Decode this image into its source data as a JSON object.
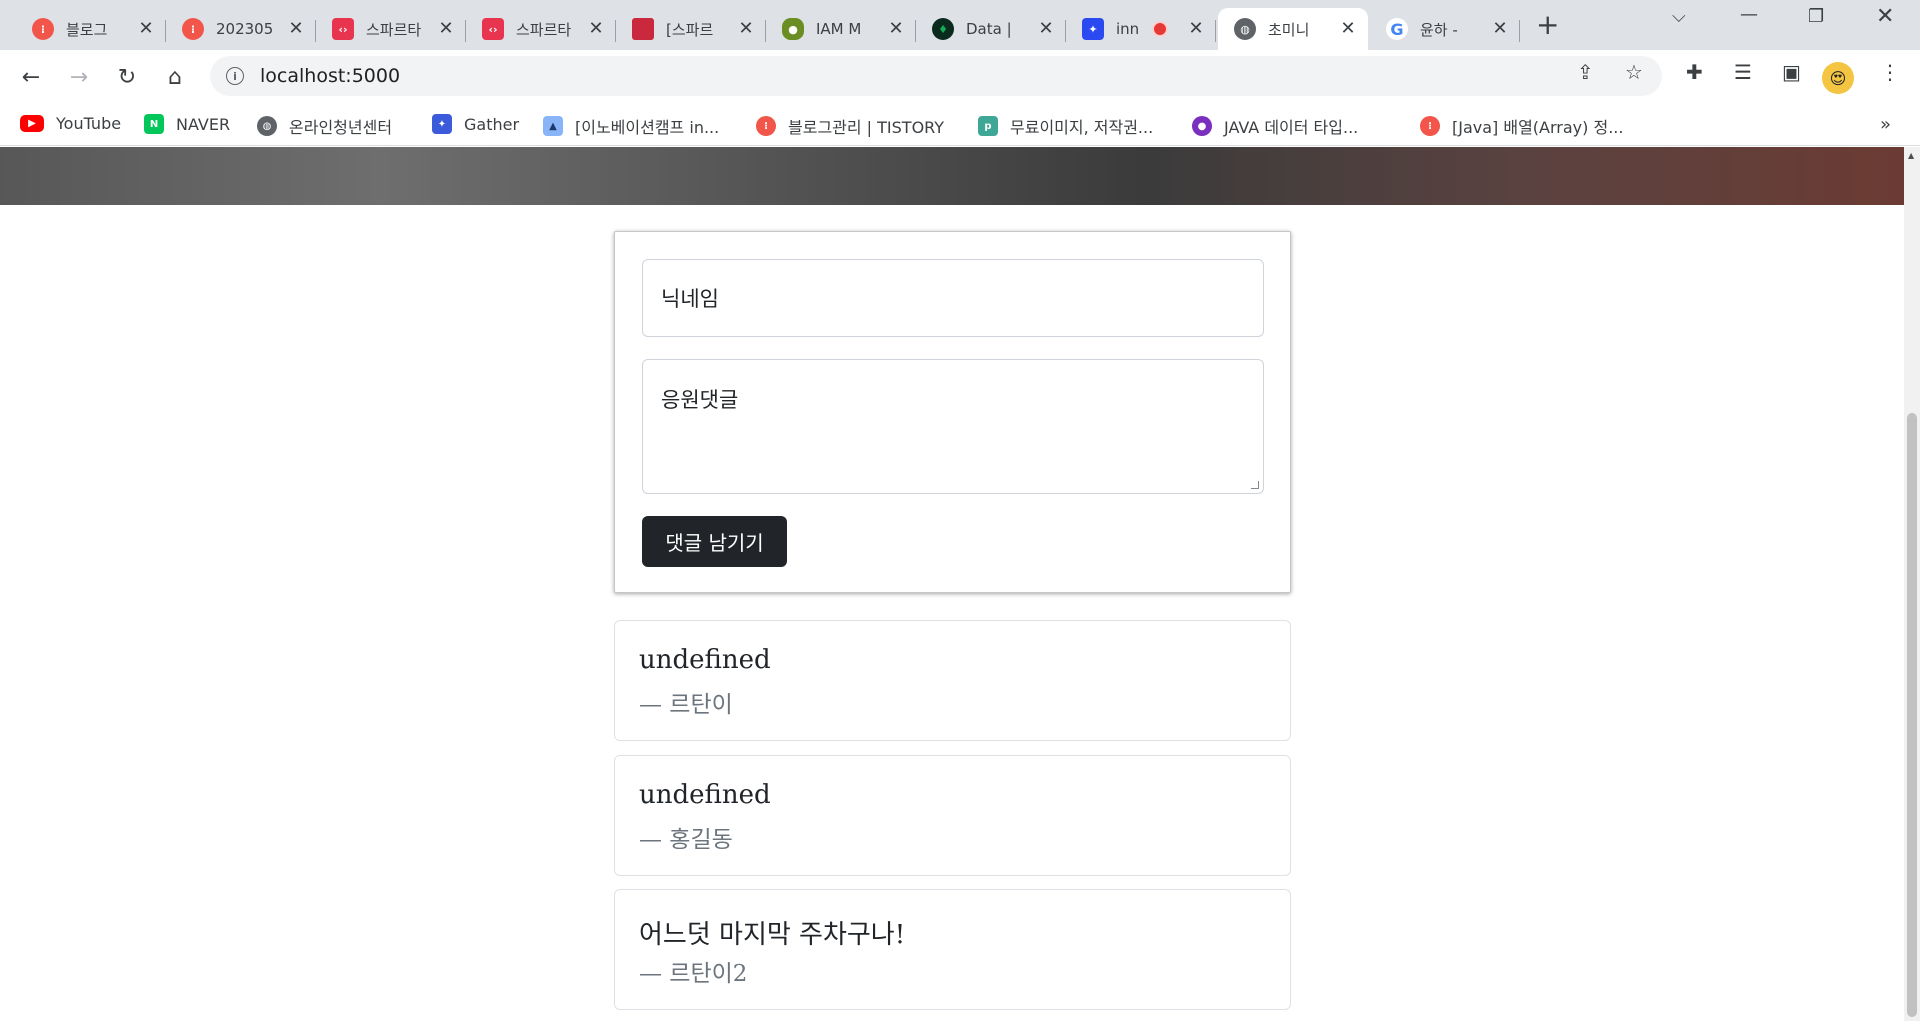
{
  "browser": {
    "tabs": [
      {
        "title": "블로그",
        "color": "#f2564a"
      },
      {
        "title": "202305",
        "color": "#f2564a"
      },
      {
        "title": "스파르타",
        "color": "#e8344e"
      },
      {
        "title": "스파르타",
        "color": "#e8344e"
      },
      {
        "title": "[스파르",
        "color": "#c9283d"
      },
      {
        "title": "IAM M",
        "color": "#6b8e23"
      },
      {
        "title": "Data | ",
        "color": "#0b2a1e"
      },
      {
        "title": "inn",
        "color": "#2b49f0"
      },
      {
        "title": "초미니",
        "color": "#5f6368",
        "active": true
      },
      {
        "title": "윤하 - ",
        "color": "#4285f4"
      }
    ],
    "new_tab_symbol": "+",
    "url": "localhost:5000",
    "bookmarks": [
      {
        "label": "YouTube",
        "color": "#ff0000"
      },
      {
        "label": "NAVER",
        "color": "#03c75a"
      },
      {
        "label": "온라인청년센터",
        "color": "#5f6368"
      },
      {
        "label": "Gather",
        "color": "#3b5bdb"
      },
      {
        "label": "[이노베이션캠프 in...",
        "color": "#8ab4f8"
      },
      {
        "label": "블로그관리 | TISTORY",
        "color": "#f2564a"
      },
      {
        "label": "무료이미지, 저작권...",
        "color": "#3fa796"
      },
      {
        "label": "JAVA 데이터 타입...",
        "color": "#7b2fbe"
      },
      {
        "label": "[Java] 배열(Array) 정...",
        "color": "#f2564a"
      }
    ],
    "bookmarks_more": "»"
  },
  "form": {
    "nickname_placeholder": "닉네임",
    "comment_placeholder": "응원댓글",
    "submit_label": "댓글 남기기"
  },
  "comments": [
    {
      "text": "undefined",
      "author": "— 르탄이"
    },
    {
      "text": "undefined",
      "author": "— 홍길동"
    },
    {
      "text": "어느덧 마지막 주차구나!",
      "author": "— 르탄이2"
    }
  ]
}
